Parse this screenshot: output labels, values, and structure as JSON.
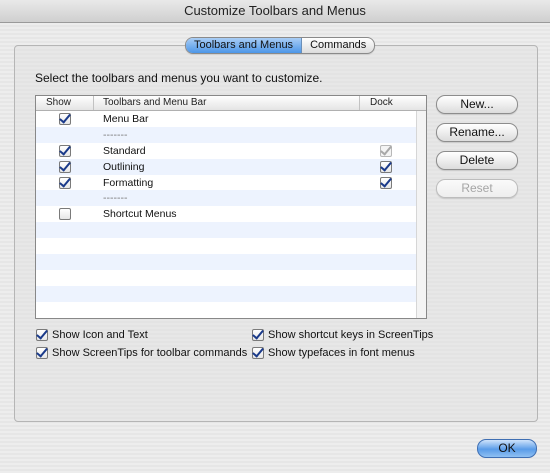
{
  "window": {
    "title": "Customize Toolbars and Menus"
  },
  "tabs": [
    {
      "label": "Toolbars and Menus",
      "active": true
    },
    {
      "label": "Commands",
      "active": false
    }
  ],
  "instruction": "Select the toolbars and menus you want to customize.",
  "table": {
    "columns": [
      "Show",
      "Toolbars and Menu Bar",
      "Dock"
    ],
    "rows": [
      {
        "name": "Menu Bar",
        "show": true,
        "dock": null
      },
      {
        "name": "-------",
        "separator": true
      },
      {
        "name": "Standard",
        "show": true,
        "dock": true,
        "dock_disabled": true
      },
      {
        "name": "Outlining",
        "show": true,
        "dock": true
      },
      {
        "name": "Formatting",
        "show": true,
        "dock": true
      },
      {
        "name": "-------",
        "separator": true
      },
      {
        "name": "Shortcut Menus",
        "show": false,
        "dock": null
      }
    ]
  },
  "buttons": {
    "new": "New...",
    "rename": "Rename...",
    "delete": "Delete",
    "reset": "Reset",
    "ok": "OK"
  },
  "options": {
    "show_icon_text": {
      "label": "Show Icon and Text",
      "checked": true
    },
    "show_screentips": {
      "label": "Show ScreenTips for toolbar commands",
      "checked": true
    },
    "show_shortcut_keys": {
      "label": "Show shortcut keys in ScreenTips",
      "checked": true
    },
    "show_typefaces": {
      "label": "Show typefaces in font menus",
      "checked": true
    }
  },
  "colors": {
    "accent": "#4c96e8",
    "row_alt": "#edf3fe",
    "check": "#1a3a8a"
  }
}
